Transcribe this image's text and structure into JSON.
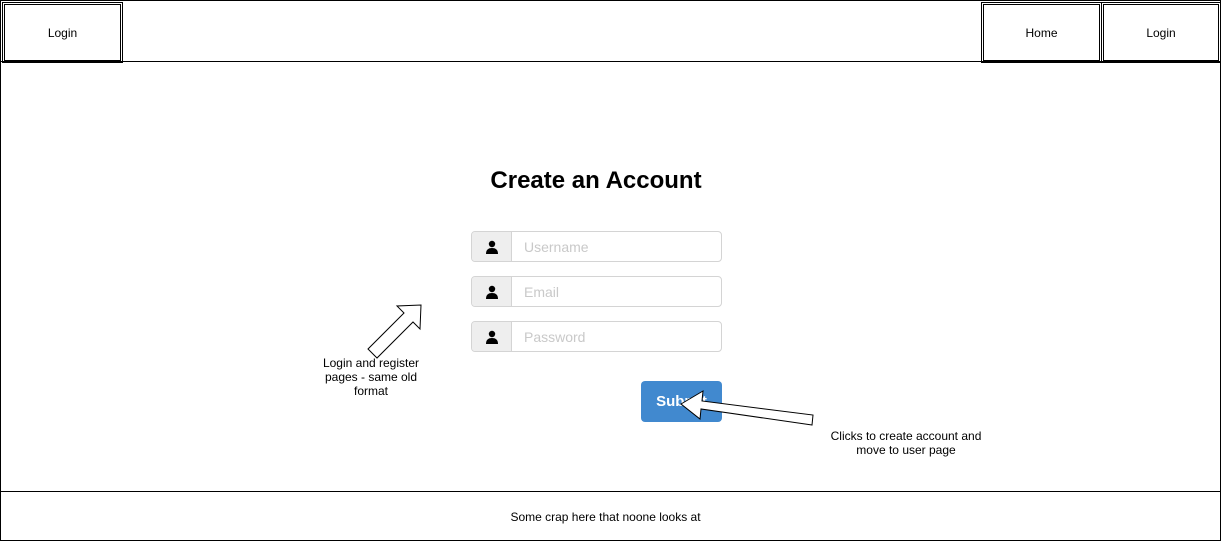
{
  "header": {
    "brand_label": "Login",
    "nav": {
      "home_label": "Home",
      "login_label": "Login"
    }
  },
  "form": {
    "title": "Create an Account",
    "fields": {
      "username": {
        "placeholder": "Username",
        "icon": "user-icon"
      },
      "email": {
        "placeholder": "Email",
        "icon": "user-icon"
      },
      "password": {
        "placeholder": "Password",
        "icon": "user-icon"
      }
    },
    "submit_label": "Submit",
    "accent_color": "#4189cf"
  },
  "annotations": {
    "left_note": "Login and register pages - same old format",
    "right_note": "Clicks to create account and move to user page"
  },
  "footer": {
    "text": "Some crap here that noone looks at"
  }
}
